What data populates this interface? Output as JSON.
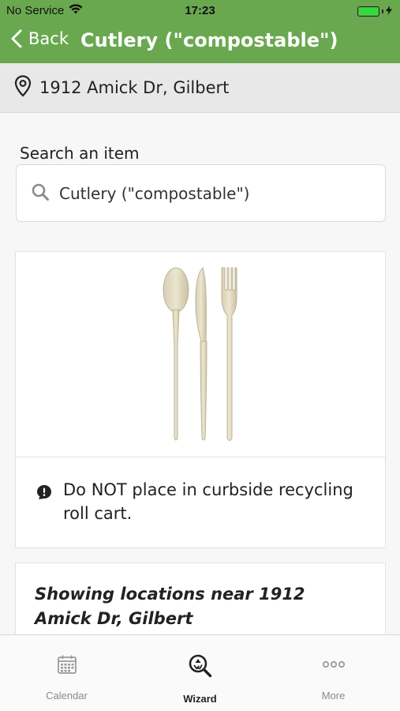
{
  "status_bar": {
    "carrier": "No Service",
    "time": "17:23",
    "battery_level": 1.0,
    "battery_color": "#2fdc3b"
  },
  "nav": {
    "back_label": "Back",
    "title": "Cutlery (\"compostable\")",
    "background": "#6aa84f"
  },
  "address": {
    "text": "1912 Amick Dr, Gilbert",
    "icon": "location-pin-icon"
  },
  "search": {
    "label": "Search an item",
    "value": "Cutlery (\"compostable\")",
    "icon": "search-icon"
  },
  "item": {
    "image": "compostable-cutlery-image",
    "notice_icon": "alert-icon",
    "notice_text": "Do NOT place in curbside recycling roll cart."
  },
  "locations": {
    "title": "Showing locations near 1912 Amick Dr, Gilbert"
  },
  "tab_bar": {
    "tabs": [
      {
        "label": "Calendar",
        "icon": "calendar-icon",
        "active": false
      },
      {
        "label": "Wizard",
        "icon": "wizard-search-icon",
        "active": true
      },
      {
        "label": "More",
        "icon": "more-icon",
        "active": false
      }
    ]
  }
}
